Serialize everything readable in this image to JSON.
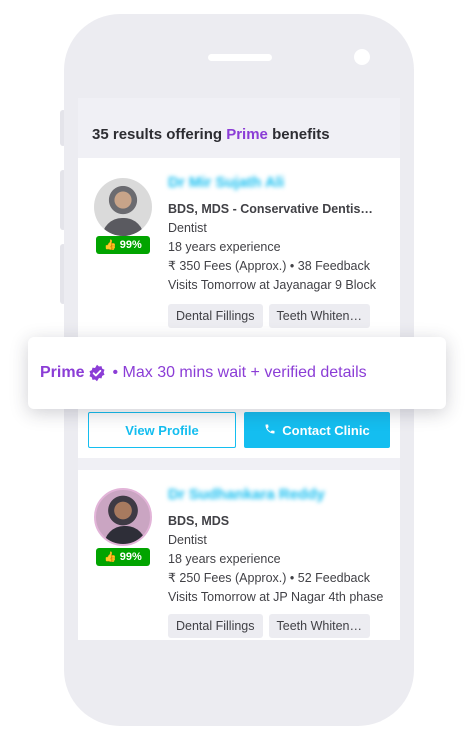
{
  "results_header": {
    "count_prefix": "35 results offering ",
    "prime_word": "Prime",
    "suffix": " benefits"
  },
  "doctors": [
    {
      "name": "Dr Mir Sujath Ali",
      "rating": "99%",
      "qualifications": "BDS, MDS - Conservative Dentis…",
      "specialty": "Dentist",
      "experience": "18 years experience",
      "fees_feedback": "₹ 350 Fees (Approx.) • 38 Feedback",
      "availability": "Visits Tomorrow at Jayanagar 9 Block",
      "services": [
        "Dental Fillings",
        "Teeth Whiten…"
      ]
    },
    {
      "name": "Dr Sudhankara Reddy",
      "rating": "99%",
      "qualifications": "BDS, MDS",
      "specialty": "Dentist",
      "experience": "18 years experience",
      "fees_feedback": "₹ 250 Fees (Approx.) • 52 Feedback",
      "availability": "Visits Tomorrow at JP Nagar 4th phase",
      "services": [
        "Dental Fillings",
        "Teeth Whiten…"
      ]
    }
  ],
  "actions": {
    "view_profile": "View Profile",
    "contact_clinic": "Contact Clinic"
  },
  "prime_banner": {
    "label": "Prime",
    "text": "• Max 30 mins wait + verified details"
  },
  "colors": {
    "prime": "#8b3dd6",
    "accent": "#14bef0",
    "rating": "#01a400"
  },
  "icons": {
    "rating": "thumbs-up-icon",
    "contact": "phone-icon",
    "prime": "verified-badge-icon"
  }
}
